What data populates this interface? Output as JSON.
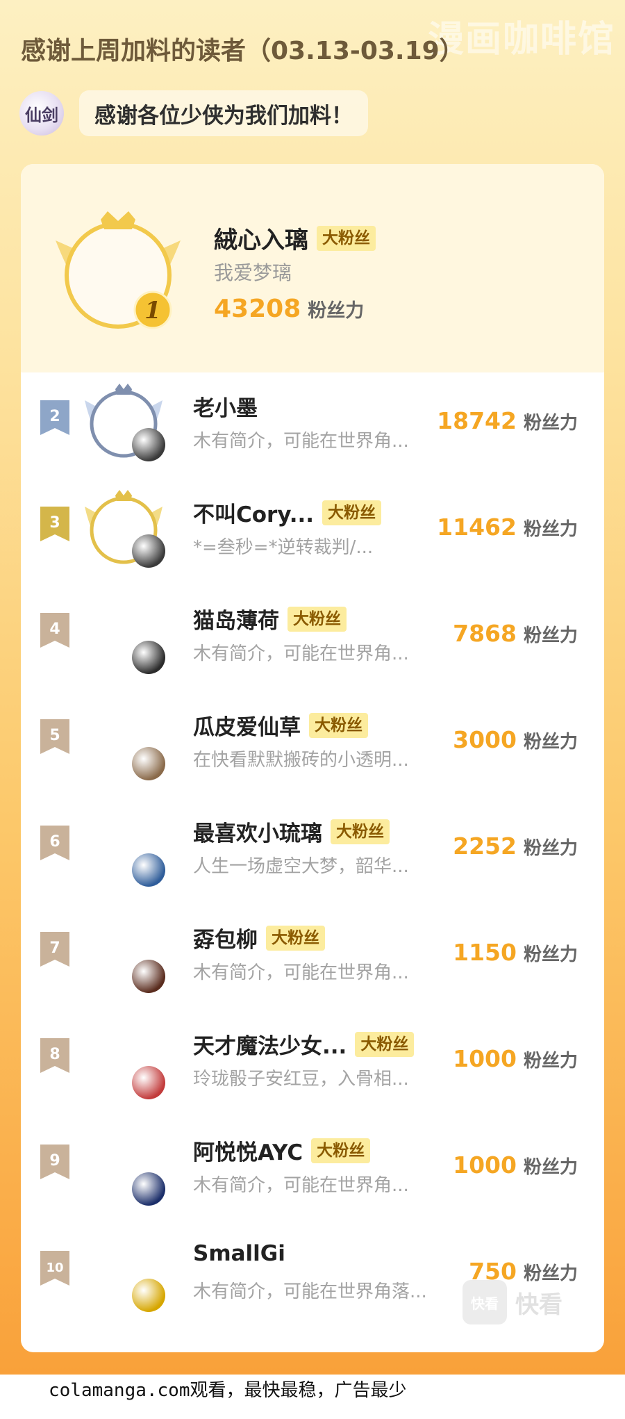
{
  "watermark": "漫画咖啡馆",
  "header": {
    "title": "感谢上周加料的读者（03.13-03.19）",
    "logo_text": "仙剑",
    "thanks": "感谢各位少侠为我们加料！"
  },
  "score_unit": "粉丝力",
  "top": {
    "rank": "1",
    "name": "絨心入璃",
    "badge": "大粉丝",
    "signature": "我爱梦璃",
    "score": "43208"
  },
  "readers": [
    {
      "rank": "2",
      "name": "老小墨",
      "badge": "",
      "signature": "木有简介，可能在世界角...",
      "score": "18742"
    },
    {
      "rank": "3",
      "name": "不叫Cory...",
      "badge": "大粉丝",
      "signature": "*=叁秒=*逆转裁判/...",
      "score": "11462"
    },
    {
      "rank": "4",
      "name": "猫岛薄荷",
      "badge": "大粉丝",
      "signature": "木有简介，可能在世界角...",
      "score": "7868"
    },
    {
      "rank": "5",
      "name": "瓜皮爱仙草",
      "badge": "大粉丝",
      "signature": "在快看默默搬砖的小透明...",
      "score": "3000"
    },
    {
      "rank": "6",
      "name": "最喜欢小琉璃",
      "badge": "大粉丝",
      "signature": "人生一场虚空大梦，韶华...",
      "score": "2252"
    },
    {
      "rank": "7",
      "name": "孬包柳",
      "badge": "大粉丝",
      "signature": "木有简介，可能在世界角...",
      "score": "1150"
    },
    {
      "rank": "8",
      "name": "天才魔法少女...",
      "badge": "大粉丝",
      "signature": "玲珑骰子安红豆，入骨相...",
      "score": "1000"
    },
    {
      "rank": "9",
      "name": "阿悦悦AYC",
      "badge": "大粉丝",
      "signature": "木有简介，可能在世界角...",
      "score": "1000"
    },
    {
      "rank": "10",
      "name": "SmallGi",
      "badge": "",
      "signature": "木有简介，可能在世界角落...",
      "score": "750"
    }
  ],
  "brand": {
    "box": "快看",
    "text": "快看"
  },
  "footer": "colamanga.com观看，最快最稳，广告最少",
  "colors": {
    "accent": "#f5a623",
    "badge_bg": "#fcec9e",
    "silver": "#8ea6c8",
    "gold": "#d4b64a",
    "plain_flag": "#c9b29a"
  }
}
